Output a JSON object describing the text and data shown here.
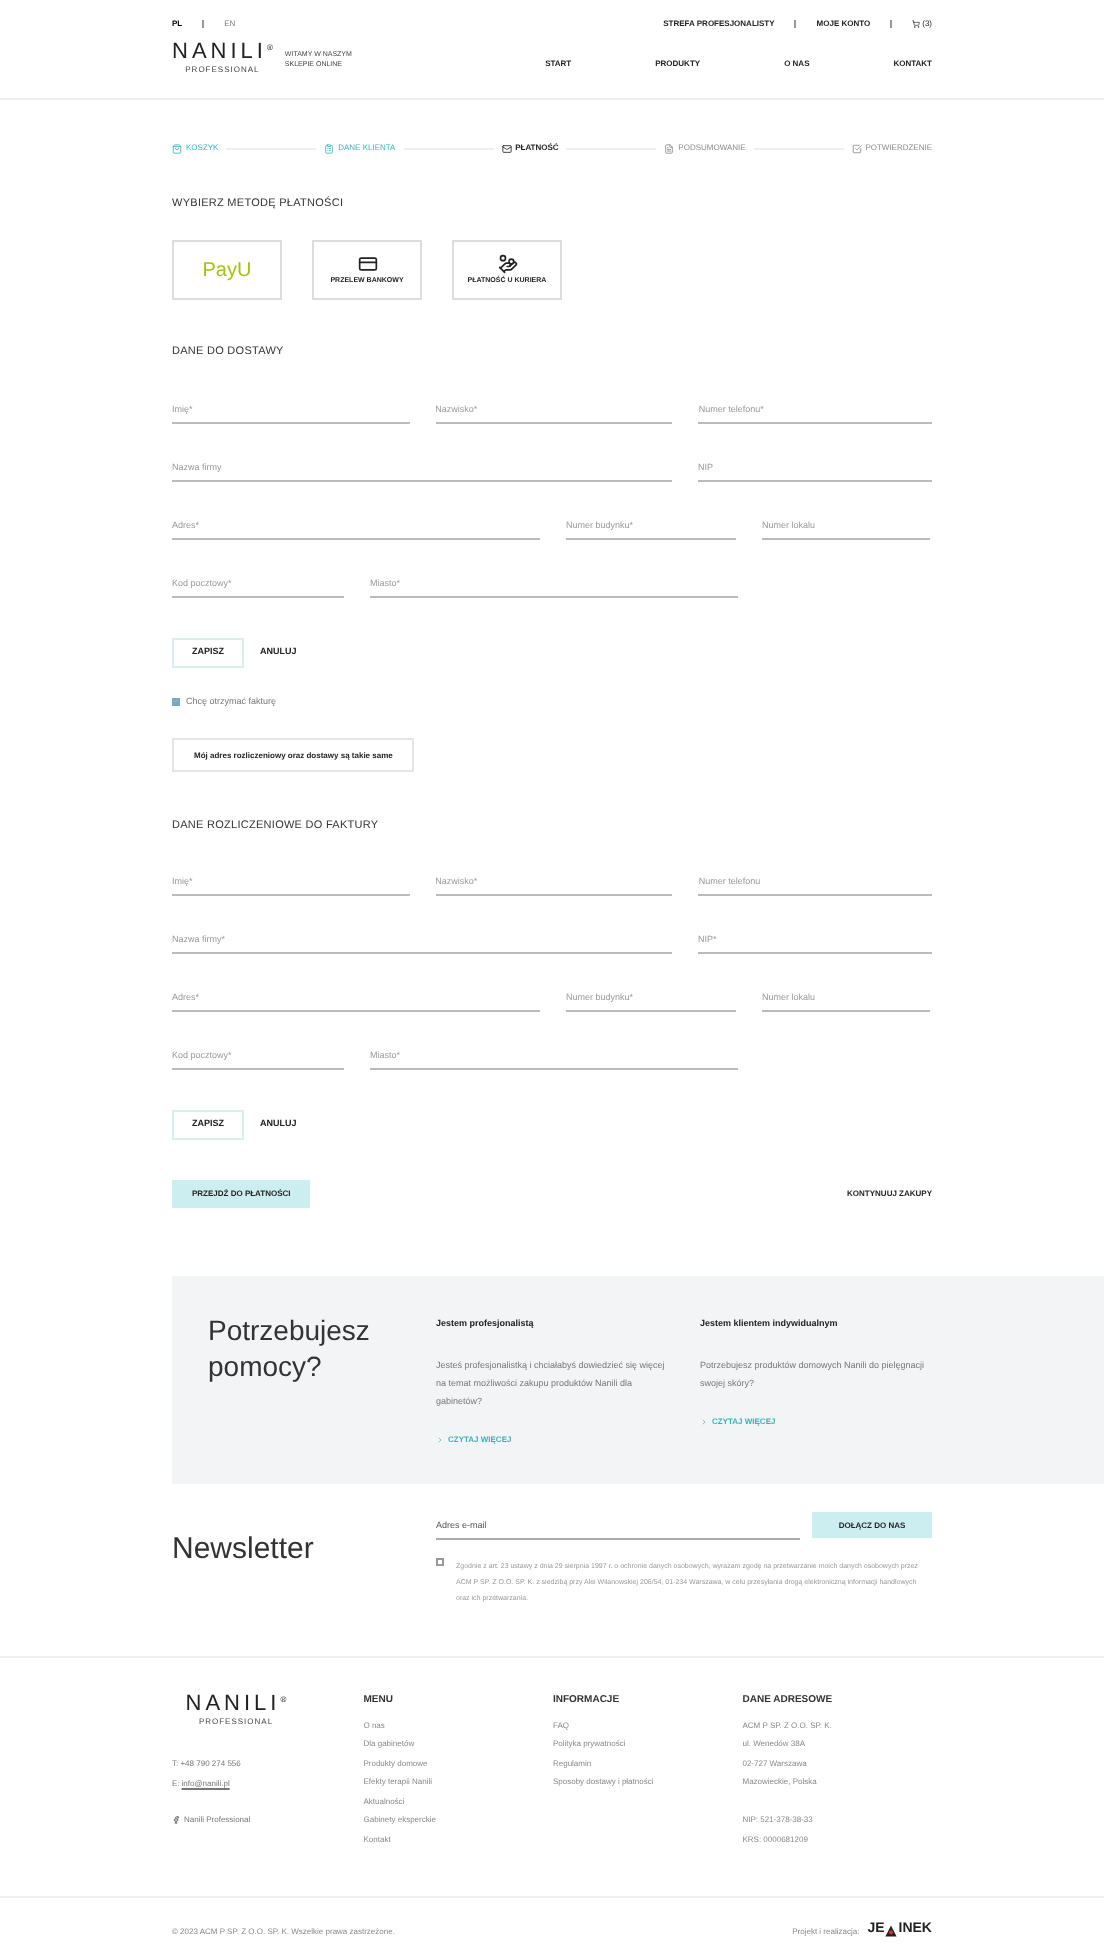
{
  "header": {
    "languages": [
      {
        "label": "PL",
        "selected": true
      },
      {
        "label": "EN",
        "selected": false
      }
    ],
    "top_links": [
      "STREFA PROFESJONALISTY",
      "MOJE KONTO"
    ],
    "cart_count": "(3)",
    "logo": {
      "name": "NANILI",
      "mark": "®",
      "sub": "PROFESSIONAL"
    },
    "tagline": "WITAMY W NASZYM SKLEPIE ONLINE",
    "nav": [
      "START",
      "PRODUKTY",
      "O NAS",
      "KONTAKT"
    ]
  },
  "steps": [
    {
      "label": "KOSZYK",
      "done": true,
      "selected": false
    },
    {
      "label": "DANE KLIENTA",
      "done": true,
      "selected": false
    },
    {
      "label": "PŁATNOŚĆ",
      "done": false,
      "selected": true
    },
    {
      "label": "PODSUMOWANIE",
      "done": false,
      "selected": false
    },
    {
      "label": "POTWIERDZENIE",
      "done": false,
      "selected": false
    }
  ],
  "payment": {
    "title": "WYBIERZ METODĘ PŁATNOŚCI",
    "methods": [
      {
        "kind": "logo",
        "label": "PayU"
      },
      {
        "kind": "bank",
        "label": "PRZELEW BANKOWY"
      },
      {
        "kind": "courier",
        "label": "PŁATNOŚĆ U KURIERA"
      }
    ]
  },
  "delivery": {
    "title": "DANE DO DOSTAWY",
    "rows": [
      [
        {
          "placeholder": "Imię*"
        },
        {
          "placeholder": "Nazwisko*"
        },
        {
          "placeholder": "Numer telefonu*"
        }
      ],
      [
        {
          "placeholder": "Nazwa firmy"
        },
        {
          "placeholder": "NIP"
        }
      ],
      [
        {
          "placeholder": "Adres*"
        },
        {
          "placeholder": "Numer budynku*"
        },
        {
          "placeholder": "Numer lokalu"
        }
      ],
      [
        {
          "placeholder": "Kod pocztowy*"
        },
        {
          "placeholder": "Miasto*"
        }
      ]
    ],
    "save": "ZAPISZ",
    "cancel": "ANULUJ"
  },
  "invoice_checkbox": {
    "label": "Chcę otrzymać fakturę",
    "checked": true
  },
  "same_address_button": "Mój adres rozliczeniowy oraz dostawy są takie same",
  "billing": {
    "title": "DANE ROZLICZENIOWE DO FAKTURY",
    "rows": [
      [
        {
          "placeholder": "Imię*"
        },
        {
          "placeholder": "Nazwisko*"
        },
        {
          "placeholder": "Numer telefonu"
        }
      ],
      [
        {
          "placeholder": "Nazwa firmy*"
        },
        {
          "placeholder": "NIP*"
        }
      ],
      [
        {
          "placeholder": "Adres*"
        },
        {
          "placeholder": "Numer budynku*"
        },
        {
          "placeholder": "Numer lokalu"
        }
      ],
      [
        {
          "placeholder": "Kod pocztowy*"
        },
        {
          "placeholder": "Miasto*"
        }
      ]
    ],
    "save": "ZAPISZ",
    "cancel": "ANULUJ"
  },
  "proceed_button": "PRZEJDŹ DO PŁATNOŚCI",
  "continue_link": "KONTYNUUJ ZAKUPY",
  "help": {
    "title": "Potrzebujesz pomocy?",
    "columns": [
      {
        "title": "Jestem profesjonalistą",
        "text": "Jesteś profesjonalistką i chciałabyś dowiedzieć się więcej na temat możliwości zakupu produktów Nanili dla gabinetów?",
        "link": "CZYTAJ WIĘCEJ"
      },
      {
        "title": "Jestem klientem indywidualnym",
        "text": "Potrzebujesz produktów domowych Nanili do pielęgnacji swojej skóry?",
        "link": "CZYTAJ WIĘCEJ"
      }
    ]
  },
  "newsletter": {
    "title": "Newsletter",
    "placeholder": "Adres e-mail",
    "button": "DOŁĄCZ DO NAS",
    "consent_checked": false,
    "consent": "Zgodnie z art. 23 ustawy z dnia 29 sierpnia 1997 r. o ochronie danych osobowych, wyrażam zgodę na przetwarzanie moich danych osobowych przez ACM P SP. Z O.O. SP. K. z siedzibą przy Alei Wilanowskiej 206/54, 01-234 Warszawa, w celu przesyłania drogą elektroniczną informacji handlowych oraz ich przetwarzania."
  },
  "footer": {
    "logo": {
      "name": "NANILI",
      "mark": "®",
      "sub": "PROFESSIONAL"
    },
    "phone": "T: +48 790 274 556",
    "email_prefix": "E:",
    "email": "info@nanili.pl",
    "facebook": "Nanili Professional",
    "columns": [
      {
        "title": "MENU",
        "items": [
          "O nas",
          "Dla gabinetów",
          "Produkty domowe",
          "Efekty terapii Nanili",
          "Aktualności",
          "Gabinety eksperckie",
          "Kontakt"
        ]
      },
      {
        "title": "INFORMACJE",
        "items": [
          "FAQ",
          "Polityka prywatności",
          "Regulamin",
          "Sposoby dostawy i płatności"
        ]
      },
      {
        "title": "DANE ADRESOWE",
        "items": [
          "ACM P SP. Z O.O. SP. K.",
          "ul. Wenedów 38A",
          "02-727 Warszawa",
          "Mazowieckie, Polska"
        ],
        "extra": [
          "NIP: 521-378-38-33",
          "KRS: 0000681209"
        ]
      }
    ],
    "copyright": "© 2023 ACM P SP. Z O.O. SP. K. Wszelkie prawa zastrzeżone.",
    "credit": "Projekt i realizacja:",
    "agency_start": "JE",
    "agency_end": "INEK"
  }
}
